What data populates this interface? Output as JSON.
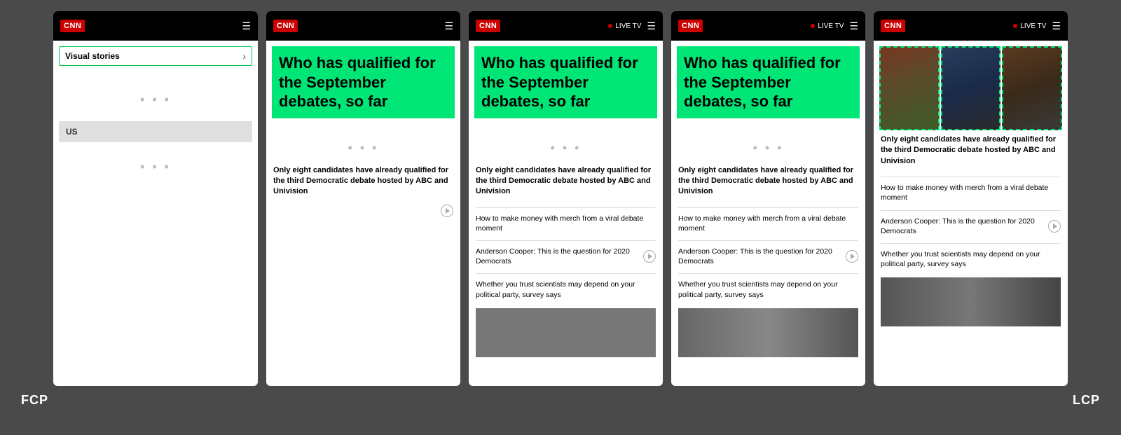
{
  "bg_color": "#4a4a4a",
  "labels": {
    "fcp": "FCP",
    "lcp": "LCP"
  },
  "cnn": {
    "logo": "CNN",
    "live_tv": "LIVE TV"
  },
  "phone1": {
    "type": "blank",
    "visual_stories_label": "Visual stories",
    "us_label": "US"
  },
  "phones": [
    {
      "id": "phone2",
      "show_live_tv": false,
      "headline": "Who has qualified for the September debates, so far",
      "main_article": "Only eight candidates have already qualified for the third Democratic debate hosted by ABC and Univision",
      "sub_articles": [
        {
          "text": "How to make money with merch from a viral debate moment",
          "has_play": false
        },
        {
          "text": "Anderson Cooper: This is the question for 2020 Democrats",
          "has_play": true
        },
        {
          "text": "Whether you trust scientists may depend on your political party, survey says",
          "has_play": false
        }
      ],
      "has_bottom_image": false,
      "has_top_image": false
    },
    {
      "id": "phone3",
      "show_live_tv": true,
      "headline": "Who has qualified for the September debates, so far",
      "main_article": "Only eight candidates have already qualified for the third Democratic debate hosted by ABC and Univision",
      "sub_articles": [
        {
          "text": "How to make money with merch from a viral debate moment",
          "has_play": false
        },
        {
          "text": "Anderson Cooper: This is the question for 2020 Democrats",
          "has_play": true
        },
        {
          "text": "Whether you trust scientists may depend on your political party, survey says",
          "has_play": false
        }
      ],
      "has_bottom_image": true,
      "has_top_image": false
    },
    {
      "id": "phone4",
      "show_live_tv": true,
      "headline": "Who has qualified for the September debates, so far",
      "main_article": "Only eight candidates have already qualified for the third Democratic debate hosted by ABC and Univision",
      "sub_articles": [
        {
          "text": "How to make money with merch from a viral debate moment",
          "has_play": false
        },
        {
          "text": "Anderson Cooper: This is the question for 2020 Democrats",
          "has_play": true
        },
        {
          "text": "Whether you trust scientists may depend on your political party, survey says",
          "has_play": false
        }
      ],
      "has_bottom_image": true,
      "has_top_image": false
    },
    {
      "id": "phone5",
      "show_live_tv": true,
      "headline": "Who has qualified for the September debates, so far",
      "main_article": "Only eight candidates have already qualified for the third Democratic debate hosted by ABC and Univision",
      "sub_articles": [
        {
          "text": "How to make money with merch from a viral debate moment",
          "has_play": false
        },
        {
          "text": "Anderson Cooper: This is the question for 2020 Democrats",
          "has_play": true
        },
        {
          "text": "Whether you trust scientists may depend on your political party, survey says",
          "has_play": false
        }
      ],
      "has_bottom_image": true,
      "has_top_image": true
    }
  ]
}
